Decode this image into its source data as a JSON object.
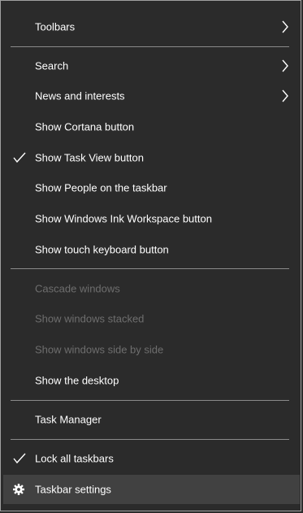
{
  "menu": {
    "items": {
      "toolbars": "Toolbars",
      "search": "Search",
      "news": "News and interests",
      "cortana": "Show Cortana button",
      "taskview": "Show Task View button",
      "people": "Show People on the taskbar",
      "ink": "Show Windows Ink Workspace button",
      "touch": "Show touch keyboard button",
      "cascade": "Cascade windows",
      "stacked": "Show windows stacked",
      "sidebyside": "Show windows side by side",
      "desktop": "Show the desktop",
      "taskmgr": "Task Manager",
      "lock": "Lock all taskbars",
      "settings": "Taskbar settings"
    },
    "checked": [
      "taskview",
      "lock"
    ],
    "submenu_items": [
      "toolbars",
      "search",
      "news"
    ],
    "disabled": [
      "cascade",
      "stacked",
      "sidebyside"
    ],
    "highlighted": "settings",
    "icons": {
      "check": "checkmark-icon",
      "submenu": "chevron-right-icon",
      "settings": "gear-icon"
    }
  }
}
